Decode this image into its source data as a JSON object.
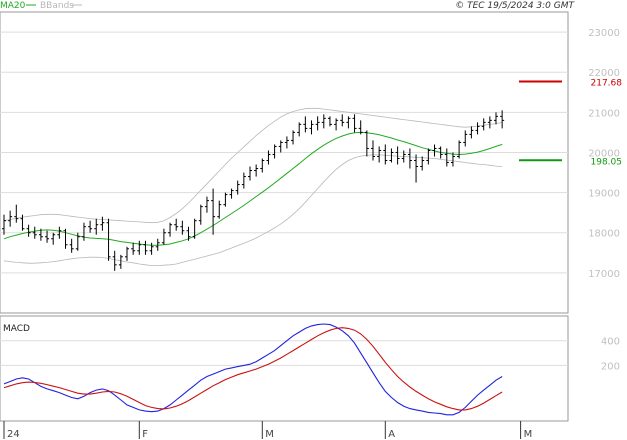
{
  "header": {
    "legend": [
      {
        "label": "MA20",
        "color": "#22aa22"
      },
      {
        "label": "BBands",
        "color": "#b8b8b8"
      }
    ],
    "source": "© TEC 19/5/2024 3:0 GMT"
  },
  "colors": {
    "price": "#000000",
    "ma20": "#22aa22",
    "bbands": "#b8b8b8",
    "macd": "#2222dd",
    "signal": "#cc1111",
    "grid": "#dddddd",
    "red_line": "#cc0000",
    "green_line": "#119911"
  },
  "chart_data": [
    {
      "type": "ohlc",
      "y_ticks": [
        17000,
        18000,
        19000,
        20000,
        21000,
        22000,
        23000
      ],
      "ylim": [
        16000,
        23500
      ],
      "x_ticks": [
        {
          "label": "24",
          "index": 0
        },
        {
          "label": "F",
          "index": 22
        },
        {
          "label": "M",
          "index": 42
        },
        {
          "label": "A",
          "index": 62
        },
        {
          "label": "M",
          "index": 84
        }
      ],
      "levels": [
        {
          "label": "217.68",
          "value": 21768,
          "color": "#cc0000"
        },
        {
          "label": "198.05",
          "value": 19805,
          "color": "#119911"
        }
      ],
      "bars": [
        [
          18100,
          18450,
          17950,
          18300
        ],
        [
          18300,
          18550,
          18150,
          18400
        ],
        [
          18400,
          18700,
          18250,
          18350
        ],
        [
          18350,
          18450,
          18050,
          18100
        ],
        [
          18100,
          18200,
          17900,
          18000
        ],
        [
          18000,
          18150,
          17850,
          17950
        ],
        [
          17950,
          18100,
          17800,
          17900
        ],
        [
          17900,
          18050,
          17750,
          17850
        ],
        [
          17850,
          18000,
          17700,
          17950
        ],
        [
          17950,
          18150,
          17850,
          18050
        ],
        [
          18050,
          18100,
          17600,
          17700
        ],
        [
          17700,
          17850,
          17500,
          17600
        ],
        [
          17600,
          18000,
          17550,
          17900
        ],
        [
          17900,
          18250,
          17800,
          18150
        ],
        [
          18150,
          18300,
          18000,
          18100
        ],
        [
          18100,
          18350,
          17950,
          18200
        ],
        [
          18200,
          18400,
          18050,
          18250
        ],
        [
          18250,
          18350,
          17300,
          17400
        ],
        [
          17400,
          17550,
          17050,
          17200
        ],
        [
          17200,
          17450,
          17100,
          17400
        ],
        [
          17400,
          17650,
          17300,
          17600
        ],
        [
          17600,
          17750,
          17450,
          17550
        ],
        [
          17550,
          17800,
          17450,
          17700
        ],
        [
          17700,
          17800,
          17450,
          17550
        ],
        [
          17550,
          17750,
          17450,
          17650
        ],
        [
          17650,
          17850,
          17550,
          17750
        ],
        [
          17750,
          18100,
          17700,
          18000
        ],
        [
          18000,
          18250,
          17900,
          18200
        ],
        [
          18200,
          18350,
          18050,
          18150
        ],
        [
          18150,
          18300,
          17950,
          18050
        ],
        [
          18050,
          18150,
          17800,
          17900
        ],
        [
          17900,
          18350,
          17850,
          18300
        ],
        [
          18300,
          18700,
          18200,
          18650
        ],
        [
          18650,
          18900,
          18500,
          18800
        ],
        [
          18800,
          19100,
          17950,
          18400
        ],
        [
          18400,
          18800,
          18350,
          18700
        ],
        [
          18700,
          19000,
          18650,
          18950
        ],
        [
          18950,
          19100,
          18850,
          19050
        ],
        [
          19050,
          19300,
          18950,
          19200
        ],
        [
          19200,
          19500,
          19100,
          19400
        ],
        [
          19400,
          19650,
          19300,
          19550
        ],
        [
          19550,
          19700,
          19400,
          19600
        ],
        [
          19600,
          19850,
          19500,
          19800
        ],
        [
          19800,
          20050,
          19700,
          19950
        ],
        [
          19950,
          20200,
          19850,
          20150
        ],
        [
          20150,
          20300,
          20000,
          20250
        ],
        [
          20250,
          20400,
          20100,
          20300
        ],
        [
          20300,
          20550,
          20200,
          20500
        ],
        [
          20500,
          20750,
          20400,
          20700
        ],
        [
          20700,
          20900,
          20500,
          20600
        ],
        [
          20600,
          20800,
          20450,
          20700
        ],
        [
          20700,
          20900,
          20550,
          20750
        ],
        [
          20750,
          20950,
          20600,
          20850
        ],
        [
          20850,
          20900,
          20650,
          20700
        ],
        [
          20700,
          20850,
          20550,
          20800
        ],
        [
          20800,
          20950,
          20650,
          20750
        ],
        [
          20750,
          20900,
          20600,
          20850
        ],
        [
          20850,
          20950,
          20500,
          20600
        ],
        [
          20600,
          20800,
          20450,
          20500
        ],
        [
          20500,
          20550,
          19900,
          20100
        ],
        [
          20100,
          20300,
          19800,
          19900
        ],
        [
          19900,
          20150,
          19750,
          20050
        ],
        [
          20050,
          20200,
          19700,
          19800
        ],
        [
          19800,
          20100,
          19750,
          20000
        ],
        [
          20000,
          20150,
          19700,
          19850
        ],
        [
          19850,
          20050,
          19750,
          19950
        ],
        [
          19950,
          20100,
          19600,
          19800
        ],
        [
          19800,
          19950,
          19250,
          19650
        ],
        [
          19650,
          19900,
          19550,
          19800
        ],
        [
          19800,
          20100,
          19700,
          20050
        ],
        [
          20050,
          20200,
          19900,
          20100
        ],
        [
          20100,
          20150,
          19850,
          19950
        ],
        [
          19950,
          20100,
          19650,
          19750
        ],
        [
          19750,
          20000,
          19650,
          19900
        ],
        [
          19900,
          20300,
          19850,
          20250
        ],
        [
          20250,
          20550,
          20150,
          20450
        ],
        [
          20450,
          20650,
          20350,
          20550
        ],
        [
          20550,
          20750,
          20450,
          20650
        ],
        [
          20650,
          20850,
          20550,
          20750
        ],
        [
          20750,
          20900,
          20600,
          20800
        ],
        [
          20800,
          21000,
          20700,
          20900
        ],
        [
          20900,
          21050,
          20600,
          20800
        ]
      ],
      "ma20": [
        17850,
        17900,
        17940,
        17980,
        18010,
        18040,
        18060,
        18070,
        18060,
        18040,
        18000,
        17960,
        17920,
        17890,
        17870,
        17860,
        17850,
        17840,
        17810,
        17780,
        17760,
        17740,
        17720,
        17700,
        17690,
        17690,
        17700,
        17720,
        17760,
        17800,
        17850,
        17920,
        18000,
        18090,
        18180,
        18280,
        18380,
        18480,
        18580,
        18680,
        18790,
        18900,
        19010,
        19120,
        19240,
        19360,
        19480,
        19600,
        19720,
        19850,
        19970,
        20080,
        20180,
        20270,
        20350,
        20410,
        20460,
        20490,
        20500,
        20490,
        20470,
        20440,
        20400,
        20360,
        20310,
        20270,
        20220,
        20170,
        20120,
        20080,
        20040,
        20000,
        19980,
        19960,
        19950,
        19960,
        19980,
        20010,
        20050,
        20100,
        20150,
        20200
      ],
      "bb_upper": [
        18300,
        18330,
        18360,
        18390,
        18410,
        18430,
        18450,
        18460,
        18460,
        18450,
        18430,
        18410,
        18390,
        18370,
        18350,
        18340,
        18330,
        18320,
        18310,
        18300,
        18290,
        18280,
        18270,
        18260,
        18250,
        18260,
        18300,
        18380,
        18480,
        18600,
        18740,
        18900,
        19060,
        19220,
        19380,
        19540,
        19700,
        19860,
        20000,
        20140,
        20280,
        20420,
        20550,
        20670,
        20780,
        20880,
        20960,
        21020,
        21060,
        21090,
        21100,
        21100,
        21080,
        21060,
        21040,
        21020,
        21000,
        20980,
        20960,
        20940,
        20920,
        20900,
        20880,
        20860,
        20840,
        20820,
        20800,
        20780,
        20760,
        20740,
        20720,
        20700,
        20680,
        20660,
        20640,
        20630,
        20640,
        20660,
        20680,
        20700,
        20720,
        20750
      ],
      "bb_lower": [
        17300,
        17280,
        17260,
        17250,
        17240,
        17240,
        17250,
        17260,
        17280,
        17300,
        17330,
        17350,
        17370,
        17380,
        17390,
        17390,
        17380,
        17360,
        17330,
        17300,
        17270,
        17250,
        17220,
        17200,
        17180,
        17180,
        17190,
        17200,
        17220,
        17260,
        17300,
        17340,
        17380,
        17420,
        17460,
        17500,
        17560,
        17620,
        17680,
        17740,
        17800,
        17870,
        17950,
        18030,
        18120,
        18220,
        18330,
        18460,
        18600,
        18760,
        18930,
        19100,
        19270,
        19430,
        19580,
        19700,
        19800,
        19870,
        19910,
        19930,
        19940,
        19940,
        19930,
        19920,
        19910,
        19900,
        19890,
        19880,
        19870,
        19860,
        19850,
        19830,
        19810,
        19790,
        19770,
        19750,
        19730,
        19710,
        19700,
        19680,
        19660,
        19650
      ]
    },
    {
      "type": "line",
      "title": "MACD",
      "y_ticks": [
        200,
        400
      ],
      "ylim": [
        -250,
        600
      ],
      "series": [
        {
          "color": "#2222dd",
          "values": [
            50,
            70,
            90,
            100,
            90,
            60,
            30,
            10,
            -5,
            -20,
            -40,
            -60,
            -70,
            -50,
            -20,
            0,
            10,
            -5,
            -40,
            -80,
            -120,
            -140,
            -160,
            -170,
            -175,
            -170,
            -150,
            -120,
            -80,
            -40,
            0,
            40,
            80,
            110,
            130,
            150,
            170,
            180,
            190,
            200,
            210,
            230,
            260,
            290,
            320,
            360,
            400,
            440,
            470,
            500,
            520,
            530,
            535,
            530,
            510,
            480,
            440,
            380,
            300,
            220,
            140,
            60,
            -10,
            -60,
            -100,
            -130,
            -150,
            -160,
            -170,
            -180,
            -185,
            -190,
            -200,
            -200,
            -180,
            -140,
            -90,
            -40,
            0,
            40,
            80,
            110
          ]
        },
        {
          "color": "#cc1111",
          "values": [
            20,
            35,
            50,
            60,
            65,
            62,
            55,
            45,
            32,
            20,
            5,
            -10,
            -25,
            -32,
            -32,
            -25,
            -15,
            -10,
            -15,
            -30,
            -50,
            -75,
            -100,
            -125,
            -140,
            -150,
            -152,
            -145,
            -130,
            -110,
            -85,
            -55,
            -25,
            5,
            35,
            60,
            85,
            105,
            125,
            140,
            155,
            170,
            190,
            210,
            235,
            260,
            290,
            320,
            350,
            380,
            410,
            440,
            465,
            485,
            500,
            505,
            500,
            485,
            455,
            410,
            355,
            290,
            225,
            165,
            110,
            65,
            25,
            -10,
            -40,
            -70,
            -95,
            -115,
            -135,
            -150,
            -160,
            -160,
            -150,
            -130,
            -105,
            -75,
            -45,
            -15
          ]
        }
      ]
    }
  ]
}
